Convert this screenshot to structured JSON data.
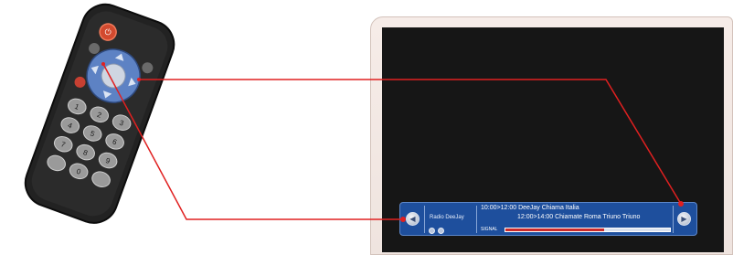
{
  "osd": {
    "channel": "Radio DeeJay",
    "epg_line1": "10:00>12:00 DeeJay Chiama Italia",
    "epg_line2": "12:00>14:00 Chiamate Roma Triuno Triuno",
    "signal_label": "SIGNAL",
    "signal_level": 0.6
  },
  "remote": {
    "power_label": "⏻",
    "keys": [
      "1",
      "2",
      "3",
      "4",
      "5",
      "6",
      "7",
      "8",
      "9",
      "0"
    ]
  },
  "colors": {
    "connector": "#e02020",
    "osd_bg": "#1e4f9d",
    "screen": "#161616",
    "remote_body": "#222222"
  }
}
